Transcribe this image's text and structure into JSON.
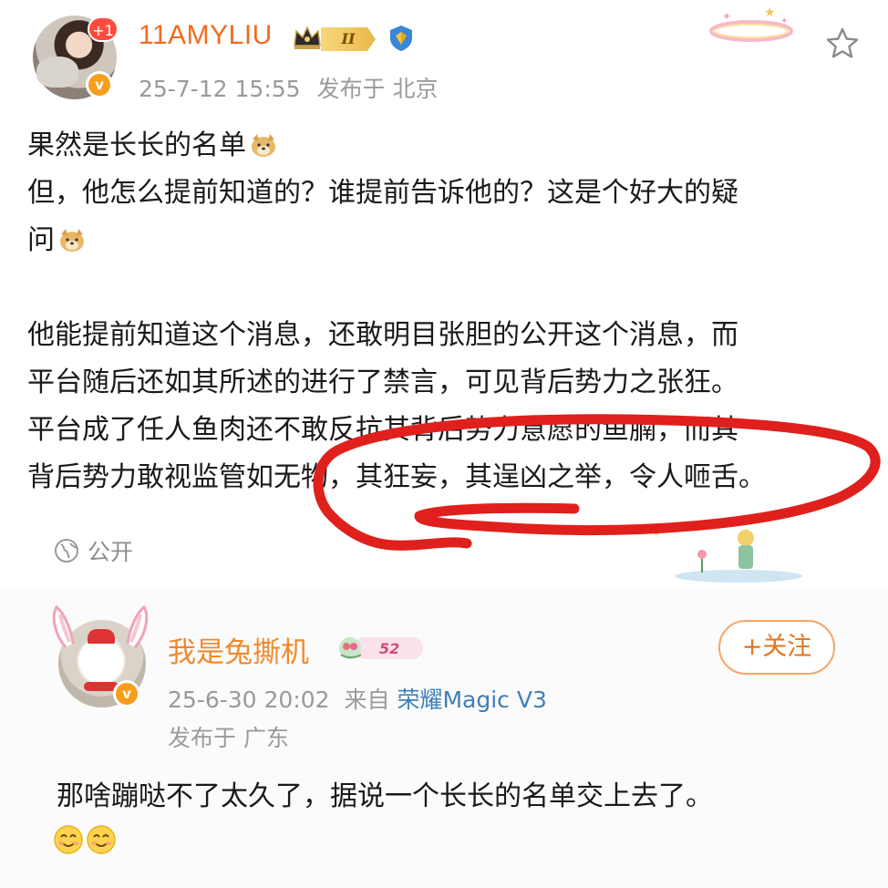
{
  "post": {
    "username": "11AMYLIU",
    "level": "II",
    "notification_badge": "+1",
    "verified_mark": "v",
    "date": "25-7-12 15:55",
    "location": "发布于 北京",
    "lines": [
      "果然是长长的名单",
      "但，他怎么提前知道的？谁提前告诉他的？这是个好大的疑",
      "问",
      "",
      "他能提前知道这个消息，还敢明目张胆的公开这个消息，而",
      "平台随后还如其所述的进行了禁言，可见背后势力之张狂。",
      "平台成了任人鱼肉还不敢反抗其背后势力意愿的鱼腩，而其",
      "背后势力敢视监管如无物，其狂妄，其逞凶之举，令人咂舌。"
    ],
    "visibility": "公开",
    "icons": [
      "crown-icon",
      "shield-icon",
      "star-icon",
      "dog-emoji-icon",
      "globe-icon"
    ],
    "annotation_color": "#e0201c"
  },
  "quoted": {
    "username": "我是兔撕机",
    "fan_level": "52",
    "follow_label": "+关注",
    "date": "25-6-30 20:02",
    "source_prefix": "来自",
    "device": "荣耀Magic V3",
    "location": "发布于 广东",
    "text": "那啥蹦哒不了太久了，据说一个长长的名单交上去了。",
    "icons": [
      "smile-emoji-icon",
      "smile-emoji-icon"
    ]
  },
  "colors": {
    "username": "#f26b1f",
    "meta": "#9a9a9a",
    "device_link": "#3f7fb8",
    "follow": "#e2761e"
  }
}
